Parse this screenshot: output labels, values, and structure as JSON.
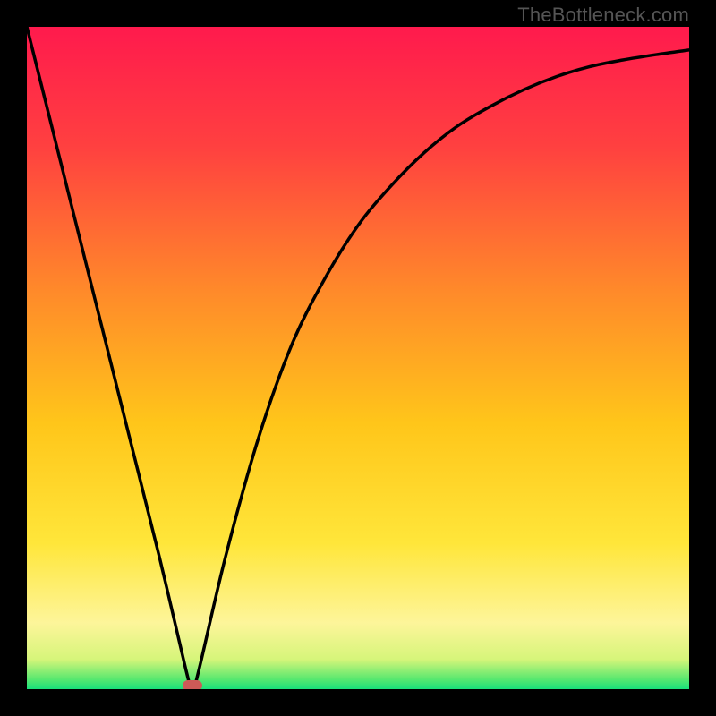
{
  "watermark": "TheBottleneck.com",
  "chart_data": {
    "type": "line",
    "title": "",
    "xlabel": "",
    "ylabel": "",
    "xlim": [
      0,
      100
    ],
    "ylim": [
      0,
      100
    ],
    "grid": false,
    "legend": false,
    "series": [
      {
        "name": "bottleneck-curve",
        "x": [
          0,
          5,
          10,
          15,
          20,
          24,
          25,
          26,
          30,
          35,
          40,
          45,
          50,
          55,
          60,
          65,
          70,
          75,
          80,
          85,
          90,
          95,
          100
        ],
        "y": [
          100,
          80,
          60,
          40,
          20,
          3,
          0,
          3,
          20,
          38,
          52,
          62,
          70,
          76,
          81,
          85,
          88,
          90.5,
          92.5,
          94,
          95,
          95.8,
          96.5
        ]
      }
    ],
    "marker": {
      "x": 25,
      "y": 0
    },
    "background_gradient_stops": [
      {
        "offset": 0.0,
        "color": "#ff1a4d"
      },
      {
        "offset": 0.18,
        "color": "#ff4040"
      },
      {
        "offset": 0.4,
        "color": "#ff8a2a"
      },
      {
        "offset": 0.6,
        "color": "#ffc61a"
      },
      {
        "offset": 0.78,
        "color": "#ffe63a"
      },
      {
        "offset": 0.9,
        "color": "#fdf59a"
      },
      {
        "offset": 0.955,
        "color": "#d6f57a"
      },
      {
        "offset": 0.985,
        "color": "#58e86f"
      },
      {
        "offset": 1.0,
        "color": "#19e07a"
      }
    ]
  }
}
